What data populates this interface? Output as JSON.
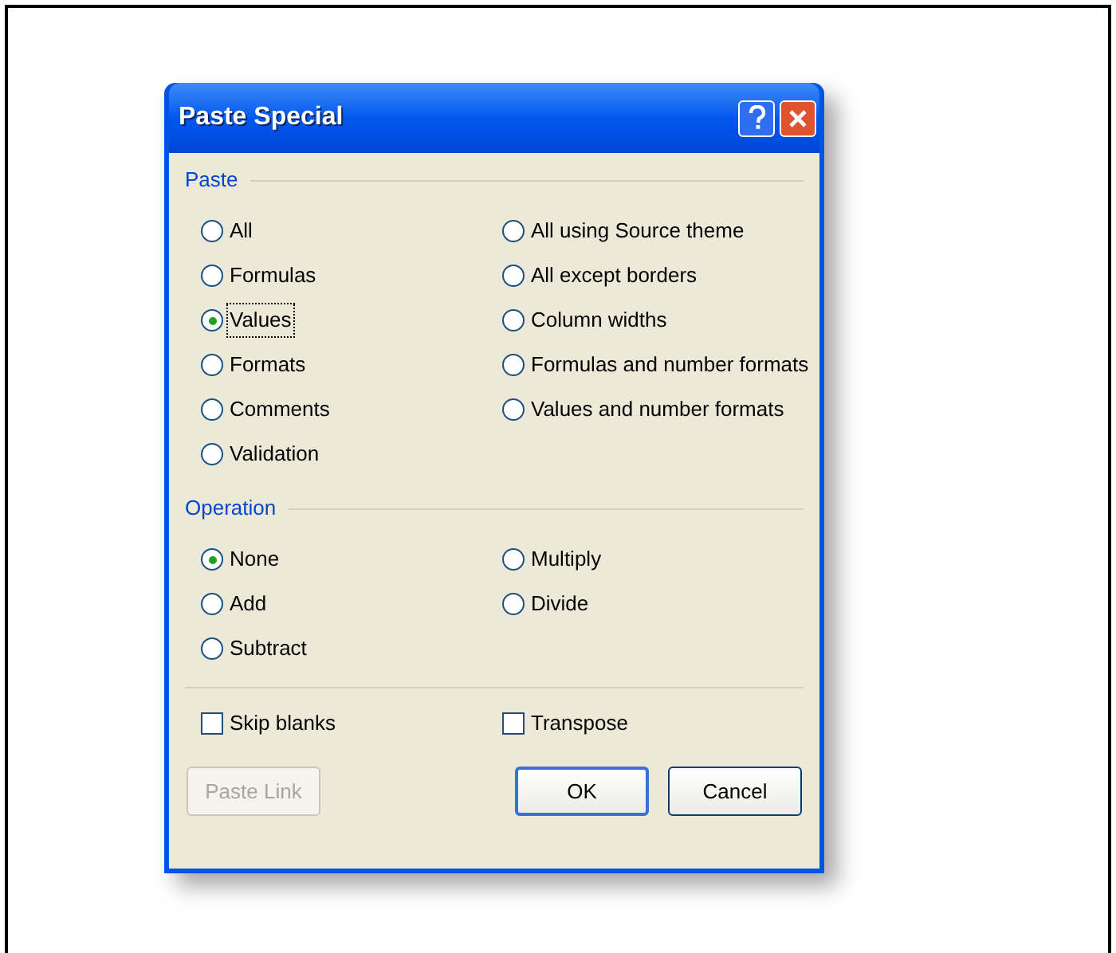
{
  "window": {
    "title": "Paste Special"
  },
  "groups": [
    {
      "label": "Paste",
      "options": [
        {
          "label": "All",
          "selected": false,
          "focused": false
        },
        {
          "label": "Formulas",
          "selected": false,
          "focused": false
        },
        {
          "label": "Values",
          "selected": true,
          "focused": true
        },
        {
          "label": "Formats",
          "selected": false,
          "focused": false
        },
        {
          "label": "Comments",
          "selected": false,
          "focused": false
        },
        {
          "label": "Validation",
          "selected": false,
          "focused": false
        },
        {
          "label": "All using Source theme",
          "selected": false,
          "focused": false
        },
        {
          "label": "All except borders",
          "selected": false,
          "focused": false
        },
        {
          "label": "Column widths",
          "selected": false,
          "focused": false
        },
        {
          "label": "Formulas and number formats",
          "selected": false,
          "focused": false
        },
        {
          "label": "Values and number formats",
          "selected": false,
          "focused": false
        }
      ]
    },
    {
      "label": "Operation",
      "options": [
        {
          "label": "None",
          "selected": true,
          "focused": false
        },
        {
          "label": "Add",
          "selected": false,
          "focused": false
        },
        {
          "label": "Subtract",
          "selected": false,
          "focused": false
        },
        {
          "label": "Multiply",
          "selected": false,
          "focused": false
        },
        {
          "label": "Divide",
          "selected": false,
          "focused": false
        }
      ]
    }
  ],
  "checkboxes": [
    {
      "label": "Skip blanks",
      "checked": false
    },
    {
      "label": "Transpose",
      "checked": false
    }
  ],
  "buttons": [
    {
      "label": "Paste Link",
      "disabled": true,
      "default": false
    },
    {
      "label": "OK",
      "disabled": false,
      "default": true
    },
    {
      "label": "Cancel",
      "disabled": false,
      "default": false
    }
  ]
}
